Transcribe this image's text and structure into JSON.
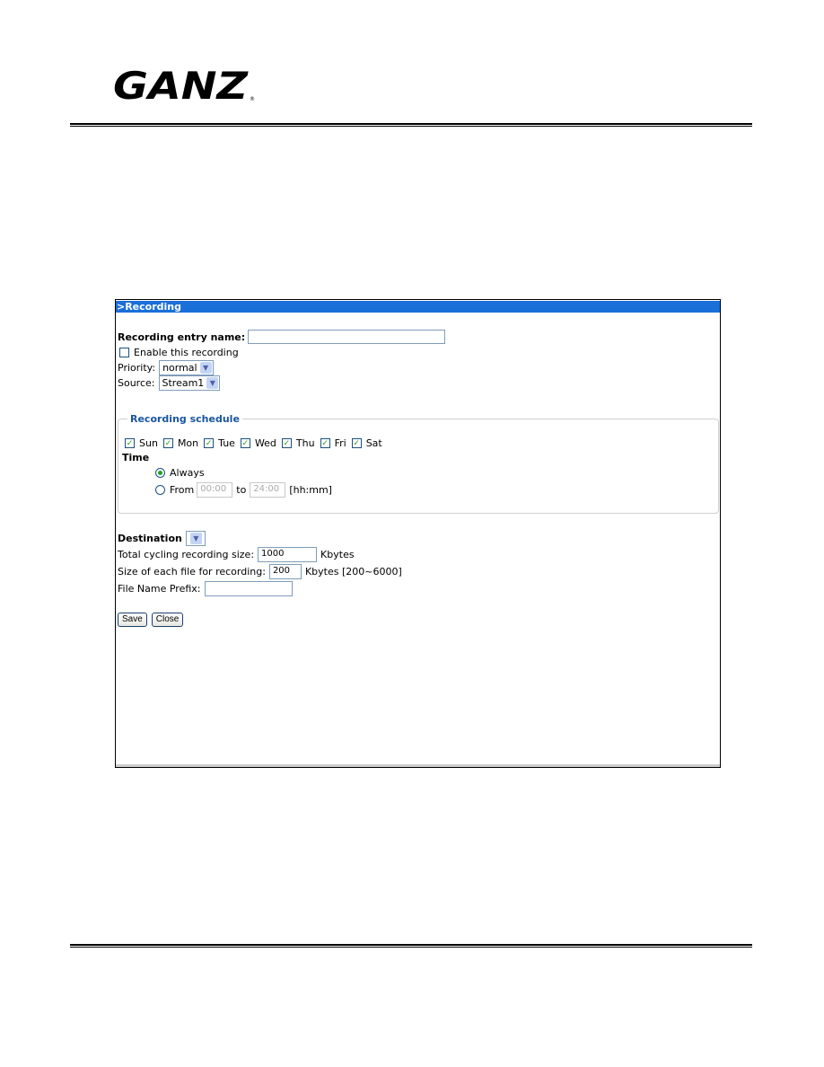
{
  "logo": {
    "text": "GANZ"
  },
  "panel": {
    "title": ">Recording",
    "entry_name_label": "Recording entry name:",
    "entry_name_value": "",
    "enable_label": "Enable this recording",
    "priority_label": "Priority:",
    "priority_value": "normal",
    "source_label": "Source:",
    "source_value": "Stream1",
    "schedule": {
      "legend": "Recording schedule",
      "days": [
        {
          "label": "Sun",
          "checked": true
        },
        {
          "label": "Mon",
          "checked": true
        },
        {
          "label": "Tue",
          "checked": true
        },
        {
          "label": "Wed",
          "checked": true
        },
        {
          "label": "Thu",
          "checked": true
        },
        {
          "label": "Fri",
          "checked": true
        },
        {
          "label": "Sat",
          "checked": true
        }
      ],
      "time_label": "Time",
      "always_label": "Always",
      "from_label": "From",
      "from_value": "00:00",
      "to_label": "to",
      "to_value": "24:00",
      "format_label": "[hh:mm]"
    },
    "destination_label": "Destination",
    "destination_value": "",
    "total_size_label": "Total cycling recording size:",
    "total_size_value": "1000",
    "total_size_unit": "Kbytes",
    "file_size_label": "Size of each file for recording:",
    "file_size_value": "200",
    "file_size_unit": "Kbytes [200~6000]",
    "prefix_label": "File Name Prefix:",
    "prefix_value": "",
    "save_label": "Save",
    "close_label": "Close"
  },
  "colors": {
    "header": "#1a6fd8",
    "check": "#21a121"
  }
}
